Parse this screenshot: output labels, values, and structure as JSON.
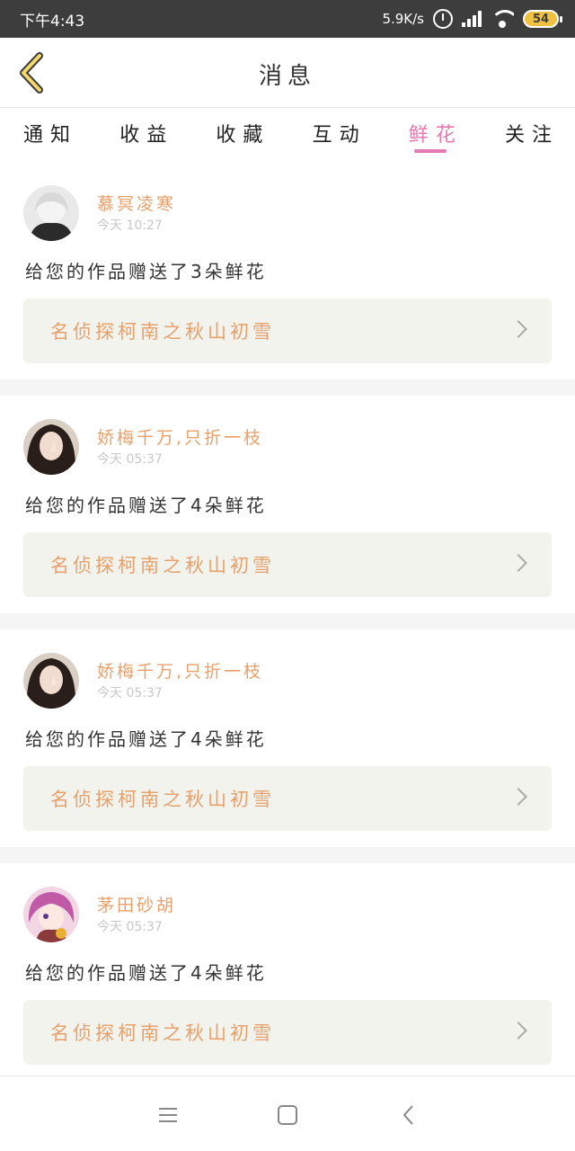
{
  "status_bar": {
    "time": "下午4:43",
    "network_speed": "5.9K/s",
    "battery_level": "54"
  },
  "header": {
    "title": "消息",
    "back_icon": "chevron-left-icon"
  },
  "tabs": [
    {
      "label": "通知",
      "active": false
    },
    {
      "label": "收益",
      "active": false
    },
    {
      "label": "收藏",
      "active": false
    },
    {
      "label": "互动",
      "active": false
    },
    {
      "label": "鲜花",
      "active": true
    },
    {
      "label": "关注",
      "active": false
    }
  ],
  "messages": [
    {
      "username": "慕冥凌寒",
      "time": "今天 10:27",
      "text": "给您的作品赠送了3朵鲜花",
      "work_title": "名侦探柯南之秋山初雪"
    },
    {
      "username": "娇梅千万,只折一枝",
      "time": "今天 05:37",
      "text": "给您的作品赠送了4朵鲜花",
      "work_title": "名侦探柯南之秋山初雪"
    },
    {
      "username": "娇梅千万,只折一枝",
      "time": "今天 05:37",
      "text": "给您的作品赠送了4朵鲜花",
      "work_title": "名侦探柯南之秋山初雪"
    },
    {
      "username": "茅田砂胡",
      "time": "今天 05:37",
      "text": "给您的作品赠送了4朵鲜花",
      "work_title": "名侦探柯南之秋山初雪"
    }
  ],
  "nav": {
    "menu_icon": "menu-icon",
    "home_icon": "square-home-icon",
    "back_icon": "back-triangle-icon"
  },
  "colors": {
    "accent_pink": "#e67ab0",
    "username_orange": "#e8a06a",
    "card_bg": "#f3f3ee",
    "status_bar": "#3d3d3d"
  }
}
